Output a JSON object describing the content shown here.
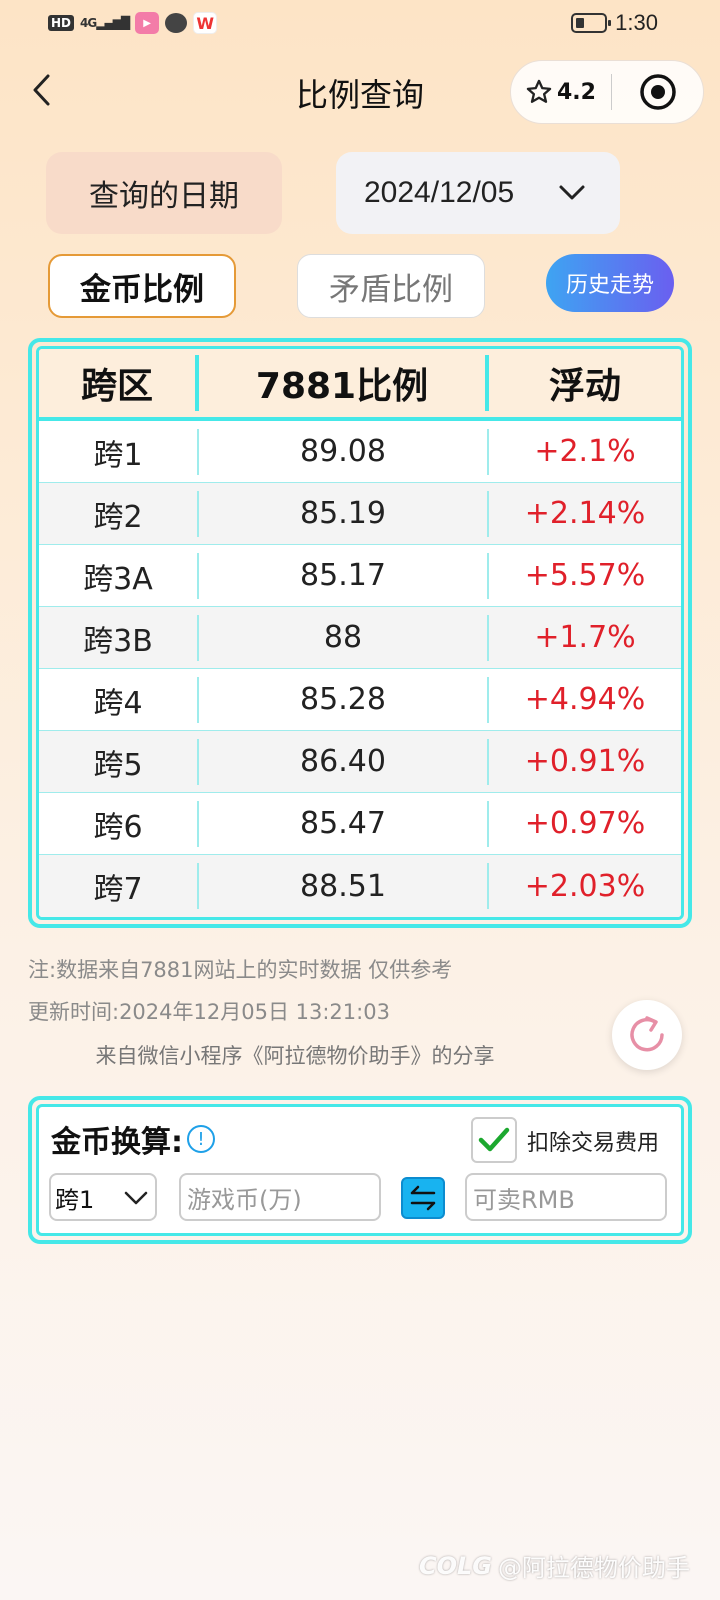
{
  "status_bar": {
    "hd": "HD",
    "signal": "4G",
    "time": "1:30"
  },
  "header": {
    "title": "比例查询",
    "rating": "4.2"
  },
  "date": {
    "label": "查询的日期",
    "value": "2024/12/05"
  },
  "tabs": {
    "gold": "金币比例",
    "dun": "矛盾比例",
    "history": "历史走势",
    "active": "gold"
  },
  "table": {
    "headers": [
      "跨区",
      "7881比例",
      "浮动"
    ],
    "rows": [
      {
        "zone": "跨1",
        "ratio": "89.08",
        "change": "+2.1%"
      },
      {
        "zone": "跨2",
        "ratio": "85.19",
        "change": "+2.14%"
      },
      {
        "zone": "跨3A",
        "ratio": "85.17",
        "change": "+5.57%"
      },
      {
        "zone": "跨3B",
        "ratio": "88",
        "change": "+1.7%"
      },
      {
        "zone": "跨4",
        "ratio": "85.28",
        "change": "+4.94%"
      },
      {
        "zone": "跨5",
        "ratio": "86.40",
        "change": "+0.91%"
      },
      {
        "zone": "跨6",
        "ratio": "85.47",
        "change": "+0.97%"
      },
      {
        "zone": "跨7",
        "ratio": "88.51",
        "change": "+2.03%"
      }
    ]
  },
  "notes": {
    "source": "注:数据来自7881网站上的实时数据 仅供参考",
    "updated": "更新时间:2024年12月05日 13:21:03",
    "share": "来自微信小程序《阿拉德物价助手》的分享"
  },
  "converter": {
    "title": "金币换算:",
    "fee_label": "扣除交易费用",
    "fee_checked": true,
    "server_selected": "跨1",
    "coin_placeholder": "游戏币(万)",
    "rmb_placeholder": "可卖RMB"
  },
  "watermark": {
    "logo": "COLG",
    "text": "@阿拉德物价助手"
  },
  "colors": {
    "accent_cyan": "#45e8e8",
    "change_red": "#e0202a",
    "tab_border_orange": "#e59a37"
  }
}
